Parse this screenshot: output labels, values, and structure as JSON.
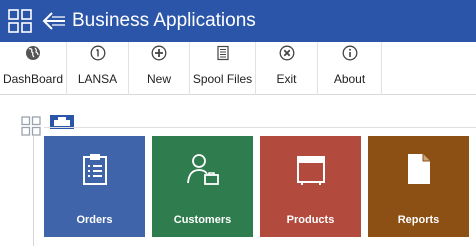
{
  "header": {
    "title": "Business Applications",
    "bg_color": "#2a55a8"
  },
  "toolbar": {
    "items": [
      {
        "label": "DashBoard",
        "icon": "globe-icon"
      },
      {
        "label": "LANSA",
        "icon": "info-circle-icon"
      },
      {
        "label": "New",
        "icon": "plus-circle-icon"
      },
      {
        "label": "Spool Files",
        "icon": "document-list-icon"
      },
      {
        "label": "Exit",
        "icon": "close-circle-icon"
      },
      {
        "label": "About",
        "icon": "info-circle-icon"
      }
    ]
  },
  "tiles": [
    {
      "label": "Orders",
      "icon": "clipboard-icon",
      "color": "#3f64a9"
    },
    {
      "label": "Customers",
      "icon": "person-briefcase-icon",
      "color": "#2f7d4e"
    },
    {
      "label": "Products",
      "icon": "box-icon",
      "color": "#b24a3e"
    },
    {
      "label": "Reports",
      "icon": "page-icon",
      "color": "#8c4f14"
    }
  ]
}
